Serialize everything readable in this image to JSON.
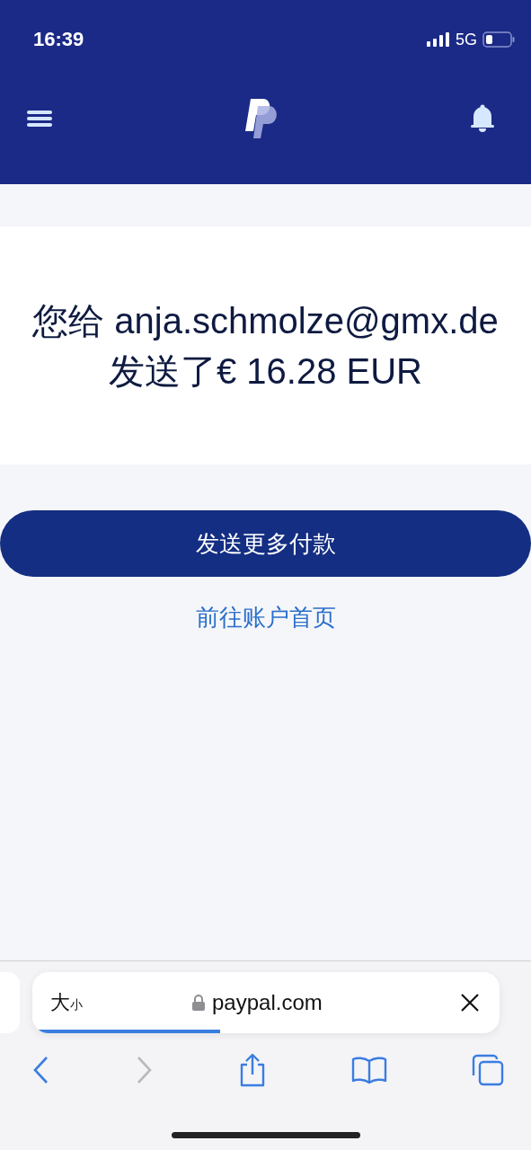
{
  "status_bar": {
    "time": "16:39",
    "network": "5G"
  },
  "message": "您给 anja.schmolze@gmx.de发送了€ 16.28 EUR",
  "primary_button": "发送更多付款",
  "secondary_link": "前往账户首页",
  "browser": {
    "text_size": {
      "large": "大",
      "small": "小"
    },
    "url": "paypal.com",
    "load_progress": {
      "level": 0.39
    },
    "nav": [
      {
        "kind": "back",
        "disabled": false
      },
      {
        "kind": "forward",
        "disabled": true
      },
      {
        "kind": "share",
        "disabled": false
      },
      {
        "kind": "bookmarks",
        "disabled": false
      },
      {
        "kind": "tabs",
        "disabled": false
      }
    ]
  }
}
